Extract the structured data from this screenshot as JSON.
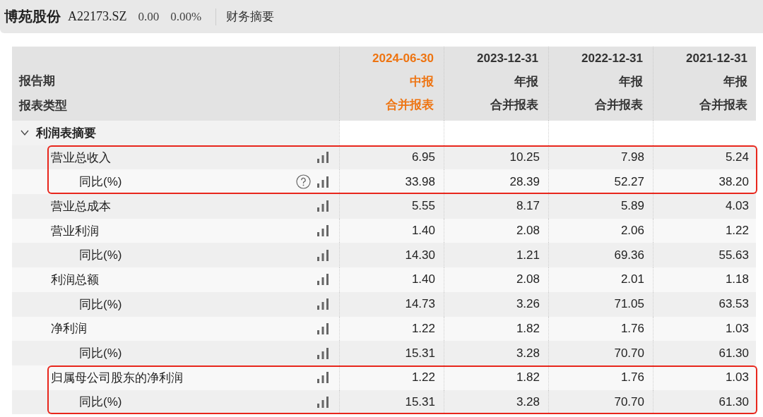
{
  "header": {
    "name": "博苑股份",
    "code": "A22173.SZ",
    "price": "0.00",
    "change": "0.00%",
    "page": "财务摘要"
  },
  "table": {
    "label_headers": [
      "报告期",
      "报表类型"
    ],
    "columns": [
      {
        "date": "2024-06-30",
        "report": "中报",
        "type": "合并报表",
        "selected": true
      },
      {
        "date": "2023-12-31",
        "report": "年报",
        "type": "合并报表",
        "selected": false
      },
      {
        "date": "2022-12-31",
        "report": "年报",
        "type": "合并报表",
        "selected": false
      },
      {
        "date": "2021-12-31",
        "report": "年报",
        "type": "合并报表",
        "selected": false
      }
    ],
    "sections": [
      {
        "title": "利润表摘要",
        "expanded": true,
        "rows": [
          {
            "label": "营业总收入",
            "values": [
              "6.95",
              "10.25",
              "7.98",
              "5.24"
            ],
            "highlighted": true,
            "help": false,
            "children": [
              {
                "label": "同比(%)",
                "values": [
                  "33.98",
                  "28.39",
                  "52.27",
                  "38.20"
                ],
                "highlighted": true,
                "help": true
              }
            ]
          },
          {
            "label": "营业总成本",
            "values": [
              "5.55",
              "8.17",
              "5.89",
              "4.03"
            ],
            "highlighted": false,
            "help": false
          },
          {
            "label": "营业利润",
            "values": [
              "1.40",
              "2.08",
              "2.06",
              "1.22"
            ],
            "highlighted": false,
            "help": false,
            "children": [
              {
                "label": "同比(%)",
                "values": [
                  "14.30",
                  "1.21",
                  "69.36",
                  "55.63"
                ],
                "highlighted": false,
                "help": false
              }
            ]
          },
          {
            "label": "利润总额",
            "values": [
              "1.40",
              "2.08",
              "2.01",
              "1.18"
            ],
            "highlighted": false,
            "help": false,
            "children": [
              {
                "label": "同比(%)",
                "values": [
                  "14.73",
                  "3.26",
                  "71.05",
                  "63.53"
                ],
                "highlighted": false,
                "help": false
              }
            ]
          },
          {
            "label": "净利润",
            "values": [
              "1.22",
              "1.82",
              "1.76",
              "1.03"
            ],
            "highlighted": false,
            "help": false,
            "children": [
              {
                "label": "同比(%)",
                "values": [
                  "15.31",
                  "3.28",
                  "70.70",
                  "61.30"
                ],
                "highlighted": false,
                "help": false
              }
            ]
          },
          {
            "label": "归属母公司股东的净利润",
            "values": [
              "1.22",
              "1.82",
              "1.76",
              "1.03"
            ],
            "highlighted": true,
            "help": false,
            "children": [
              {
                "label": "同比(%)",
                "values": [
                  "15.31",
                  "3.28",
                  "70.70",
                  "61.30"
                ],
                "highlighted": true,
                "help": false
              }
            ]
          }
        ]
      }
    ]
  }
}
